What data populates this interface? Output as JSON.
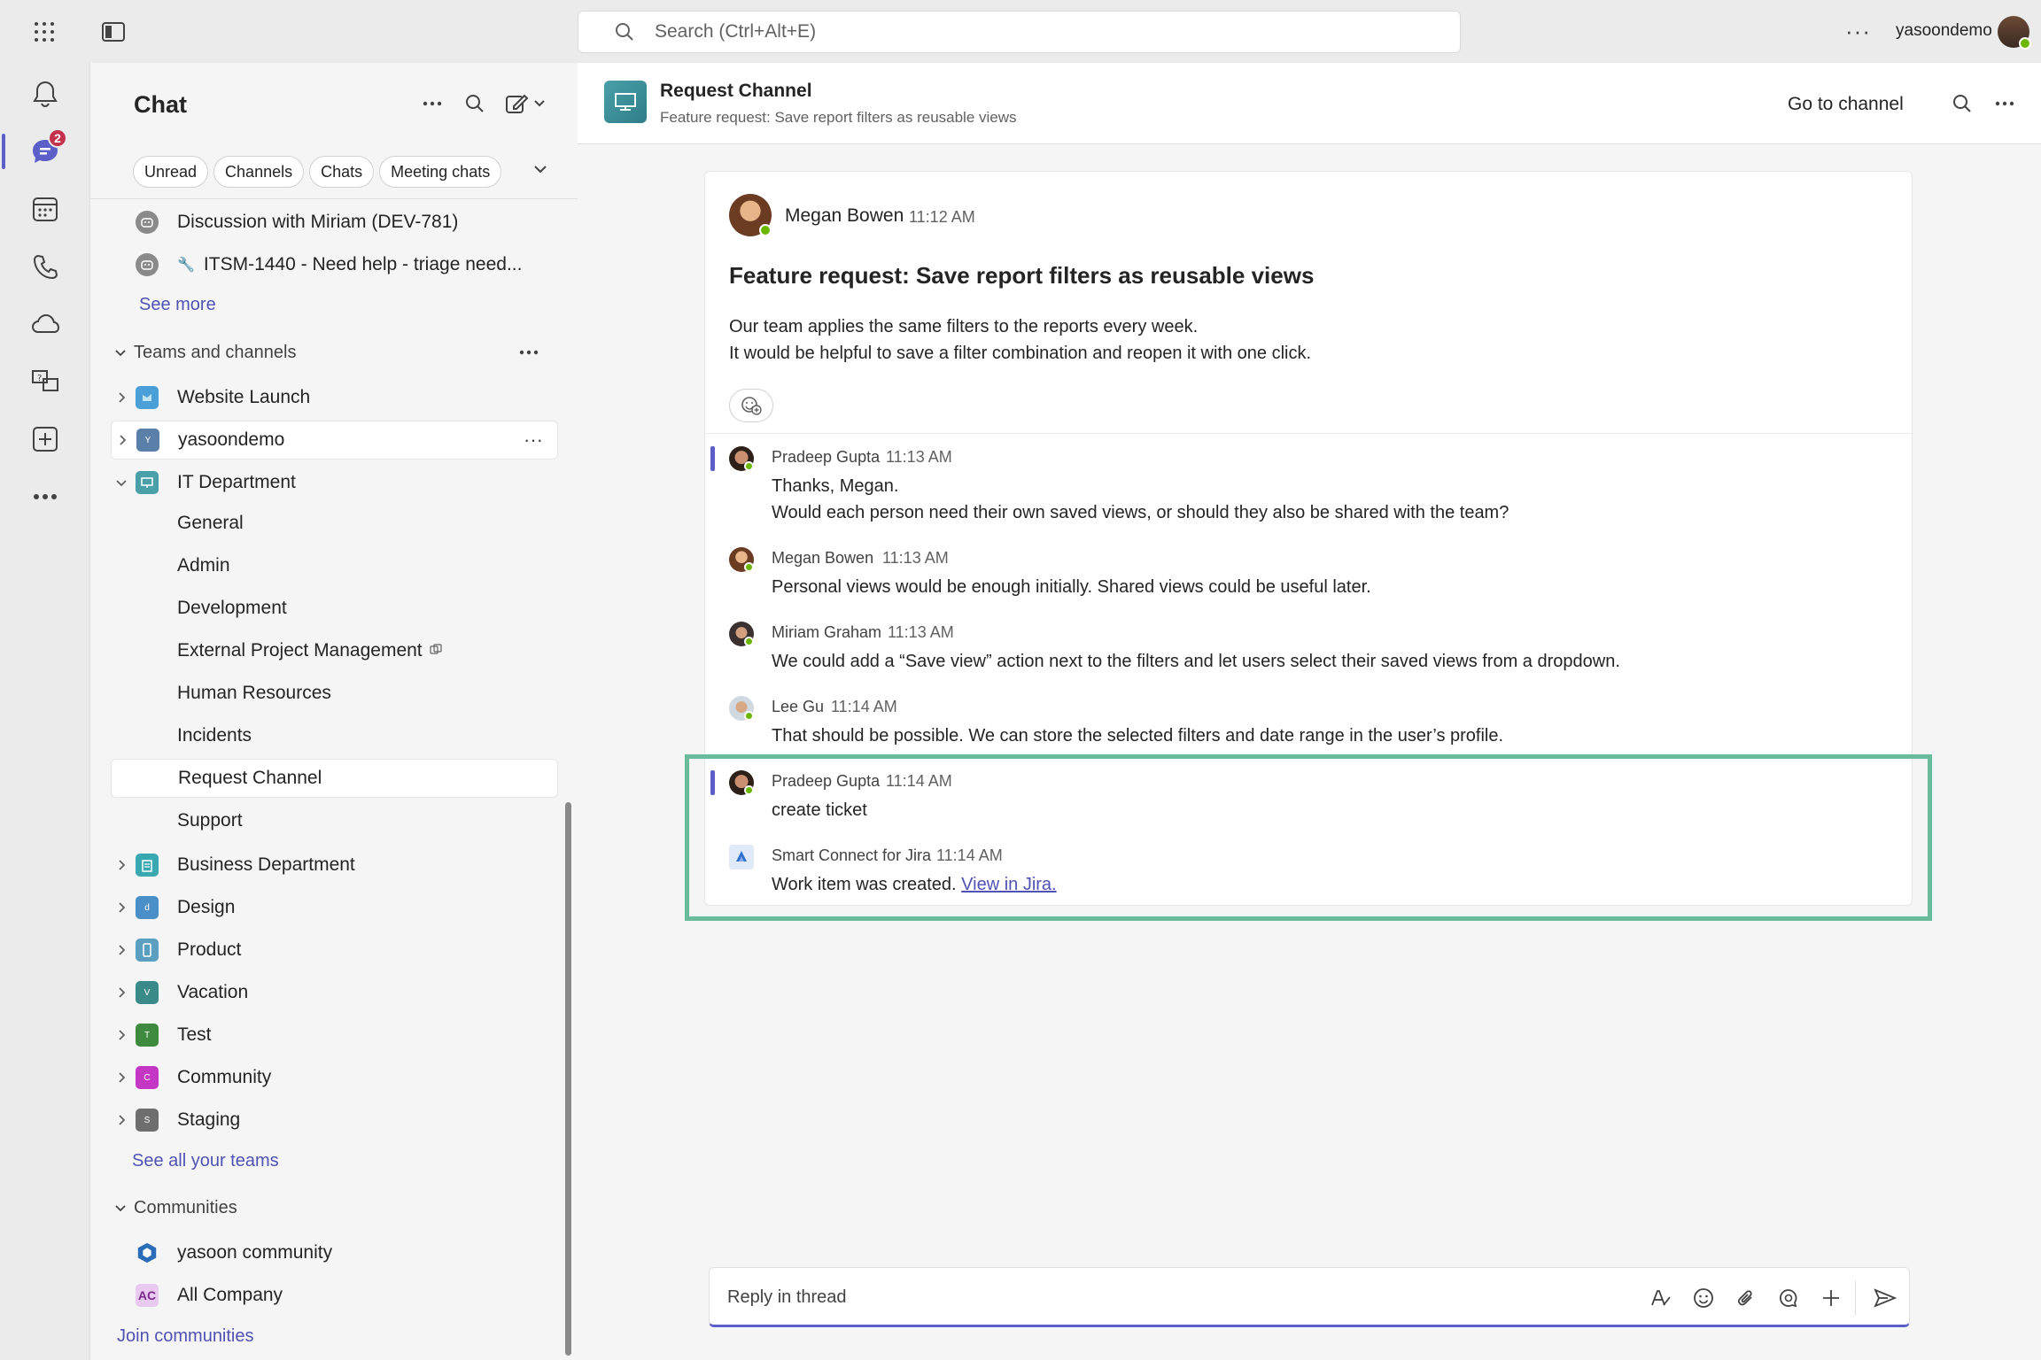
{
  "topbar": {
    "search_placeholder": "Search (Ctrl+Alt+E)",
    "more": "···",
    "username": "yasoondemo"
  },
  "rail": {
    "chat_badge": "2",
    "items": [
      "activity-icon",
      "chat-icon",
      "calendar-icon",
      "calls-icon",
      "onedrive-icon",
      "help-icon",
      "apps-icon",
      "more-icon"
    ]
  },
  "sidebar": {
    "title": "Chat",
    "filters": [
      "Unread",
      "Channels",
      "Chats",
      "Meeting chats"
    ],
    "chats": [
      {
        "label": "Discussion with Miriam (DEV-781)"
      },
      {
        "label": "ITSM-1440 - Need help - triage need..."
      }
    ],
    "see_more": "See more",
    "teams_header": "Teams and channels",
    "teams": [
      {
        "label": "Website Launch",
        "icon_color": "#4a9fd8"
      },
      {
        "label": "yasoondemo",
        "icon_color": "#5a7fa8",
        "letter": "Y"
      },
      {
        "label": "IT Department",
        "icon_color": "#4aa0a8"
      }
    ],
    "channels": [
      "General",
      "Admin",
      "Development",
      "External Project Management",
      "Human Resources",
      "Incidents",
      "Request Channel",
      "Support"
    ],
    "teams2": [
      {
        "label": "Business Department",
        "icon_color": "#3aa8b0",
        "letter": ""
      },
      {
        "label": "Design",
        "icon_color": "#4a8fc8",
        "letter": "d"
      },
      {
        "label": "Product",
        "icon_color": "#5a9fc0",
        "letter": ""
      },
      {
        "label": "Vacation",
        "icon_color": "#3a8a8a",
        "letter": "V"
      },
      {
        "label": "Test",
        "icon_color": "#3e8a3e",
        "letter": "T"
      },
      {
        "label": "Community",
        "icon_color": "#c436c4",
        "letter": "C"
      },
      {
        "label": "Staging",
        "icon_color": "#6e6e6e",
        "letter": "S"
      }
    ],
    "see_all_teams": "See all your teams",
    "communities_header": "Communities",
    "communities": [
      {
        "label": "yasoon community"
      },
      {
        "label": "All Company",
        "abbr": "AC"
      }
    ],
    "join_communities": "Join communities"
  },
  "channel": {
    "title": "Request Channel",
    "subtitle": "Feature request: Save report filters as reusable views",
    "go_to_channel": "Go to channel"
  },
  "post": {
    "author": "Megan Bowen",
    "time": "11:12 AM",
    "title": "Feature request: Save report filters as reusable views",
    "body_line1": "Our team applies the same filters to the reports every week.",
    "body_line2": "It would be helpful to save a filter combination and reopen it with one click."
  },
  "replies": [
    {
      "author": "Pradeep Gupta",
      "time": "11:13 AM",
      "line1": "Thanks, Megan.",
      "line2": "Would each person need their own saved views, or should they also be shared with the team?"
    },
    {
      "author": "Megan Bowen",
      "time": "11:13 AM",
      "line1": "Personal views would be enough initially. Shared views could be useful later."
    },
    {
      "author": "Miriam Graham",
      "time": "11:13 AM",
      "line1": "We could add a “Save view” action next to the filters and let users select their saved views from a dropdown."
    },
    {
      "author": "Lee Gu",
      "time": "11:14 AM",
      "line1": "That should be possible. We can store the selected filters and date range in the user’s profile."
    },
    {
      "author": "Pradeep Gupta",
      "time": "11:14 AM",
      "line1": "create ticket"
    },
    {
      "author": "Smart Connect for Jira",
      "time": "11:14 AM",
      "line1": "Work item was created.",
      "link": "View in Jira."
    }
  ],
  "composer": {
    "placeholder": "Reply in thread"
  },
  "colors": {
    "accent": "#5b5fc7",
    "highlight": "#6aba9c",
    "badge": "#c4314b",
    "presence": "#6bb700"
  }
}
